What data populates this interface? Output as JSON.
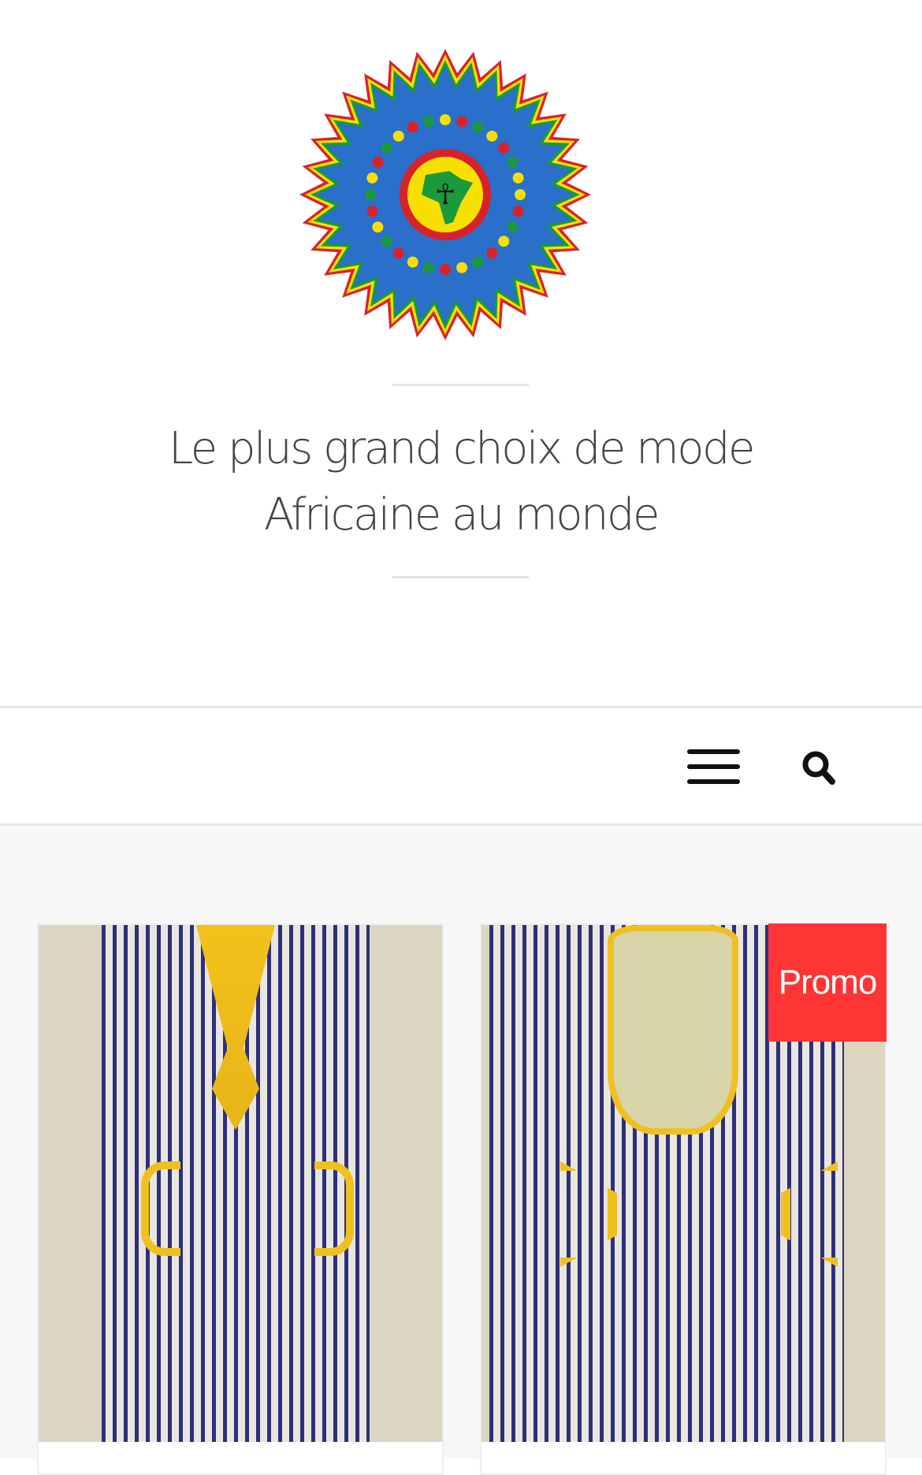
{
  "header": {
    "logo_alt": "African fashion emblem",
    "tagline_line1": "Le plus grand choix de mode",
    "tagline_line2": "Africaine au monde"
  },
  "nav": {
    "menu_icon": "hamburger-icon",
    "search_icon": "search-icon"
  },
  "colors": {
    "promo": "#ff3434",
    "logo_blue": "#2a6fc9",
    "logo_yellow": "#f7e000",
    "logo_green": "#1a9a3c",
    "logo_red": "#d8222a"
  },
  "products": [
    {
      "badge": null
    },
    {
      "badge": "Promo"
    }
  ]
}
